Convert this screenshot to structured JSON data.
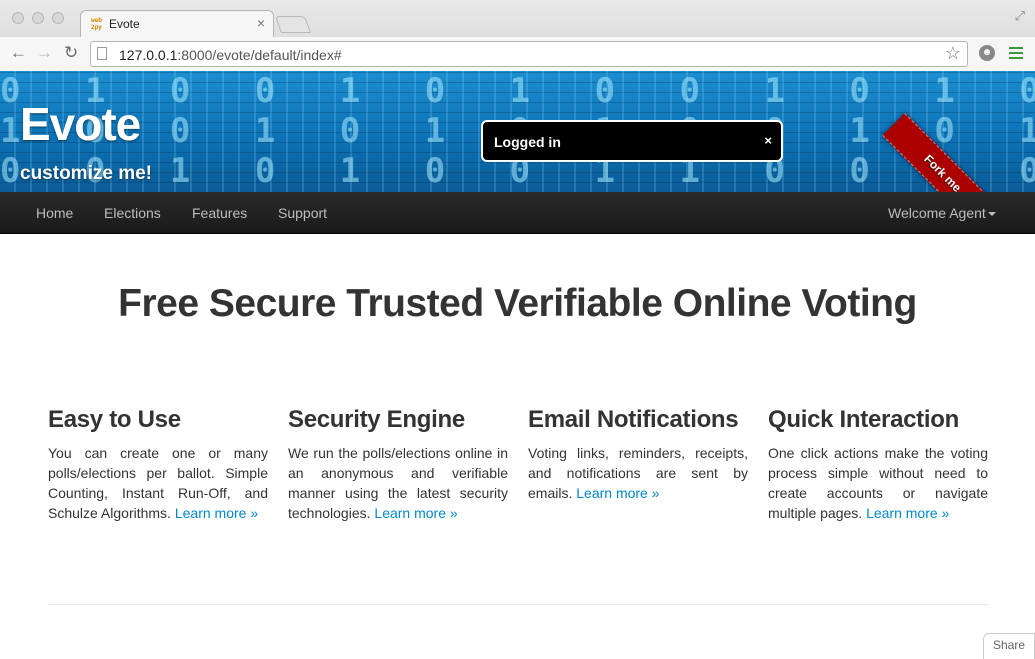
{
  "browser": {
    "tab_title": "Evote",
    "tab_favicon_text": "web2py",
    "url_host": "127.0.0.1",
    "url_rest": ":8000/evote/default/index#"
  },
  "banner": {
    "brand": "Evote",
    "tagline": "customize me!",
    "flash_message": "Logged in",
    "flash_close": "×",
    "ribbon": "Fork me on GitHub"
  },
  "navbar": {
    "items": [
      "Home",
      "Elections",
      "Features",
      "Support"
    ],
    "user_menu": "Welcome Agent"
  },
  "main": {
    "headline": "Free Secure Trusted Verifiable Online Voting",
    "features": [
      {
        "title": "Easy to Use",
        "text": "You can create one or many polls/elections per ballot. Simple Counting, Instant Run-Off, and Schulze Algorithms.",
        "link": "Learn more »"
      },
      {
        "title": "Security Engine",
        "text": "We run the polls/elections online in an anonymous and verifiable manner using the latest security technologies.",
        "link": "Learn more »"
      },
      {
        "title": "Email Notifications",
        "text": "Voting links, reminders, receipts, and notifications are sent by emails.",
        "link": "Learn more »"
      },
      {
        "title": "Quick Interaction",
        "text": "One click actions make the voting process simple without need to create accounts or navigate multiple pages.",
        "link": "Learn more »"
      }
    ]
  },
  "share_button": "Share",
  "colors": {
    "link": "#0088cc",
    "navbar_bg": "#1f1f1f",
    "ribbon": "#aa0000"
  }
}
